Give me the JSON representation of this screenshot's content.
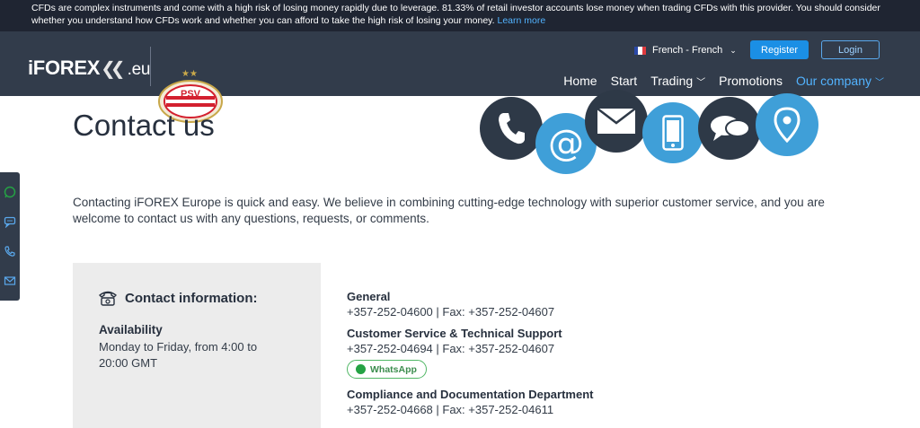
{
  "risk_warning": {
    "text": "CFDs are complex instruments and come with a high risk of losing money rapidly due to leverage. 81.33% of retail investor accounts lose money when trading CFDs with this provider.  You should consider whether you understand how CFDs work and whether you can afford to take the high risk of losing your money.",
    "learn_more": "Learn more"
  },
  "header": {
    "logo_text": "iFOREX",
    "logo_suffix": ".eu",
    "sponsor_badge": "PSV",
    "language": "French - French",
    "register_label": "Register",
    "login_label": "Login"
  },
  "nav": {
    "items": [
      {
        "label": "Home"
      },
      {
        "label": "Start"
      },
      {
        "label": "Trading"
      },
      {
        "label": "Promotions"
      },
      {
        "label": "Our company"
      }
    ]
  },
  "page": {
    "title": "Contact us",
    "intro": "Contacting iFOREX Europe is quick and easy. We believe in combining cutting-edge technology with superior customer service, and you are welcome to contact us with any questions, requests, or comments."
  },
  "contact_info": {
    "heading": "Contact information:",
    "availability_label": "Availability",
    "availability_text": "Monday to Friday, from 4:00 to 20:00 GMT"
  },
  "departments": [
    {
      "title": "General",
      "phone": "+357-252-04600 | Fax: +357-252-04607"
    },
    {
      "title": "Customer Service & Technical Support",
      "phone": "+357-252-04694 | Fax: +357-252-04607",
      "button": "WhatsApp"
    },
    {
      "title": "Compliance and Documentation Department",
      "phone": "+357-252-04668 | Fax: +357-252-04611"
    }
  ],
  "colors": {
    "banner_bg": "#1f2532",
    "header_bg": "#323c4b",
    "accent_blue": "#1b8fe5",
    "link_blue": "#52b3ff",
    "whatsapp_green": "#25a244"
  },
  "icons": [
    "phone-icon",
    "at-sign-icon",
    "envelope-icon",
    "mobile-icon",
    "chat-bubbles-icon",
    "location-pin-icon",
    "telephone-icon",
    "whatsapp-icon"
  ]
}
